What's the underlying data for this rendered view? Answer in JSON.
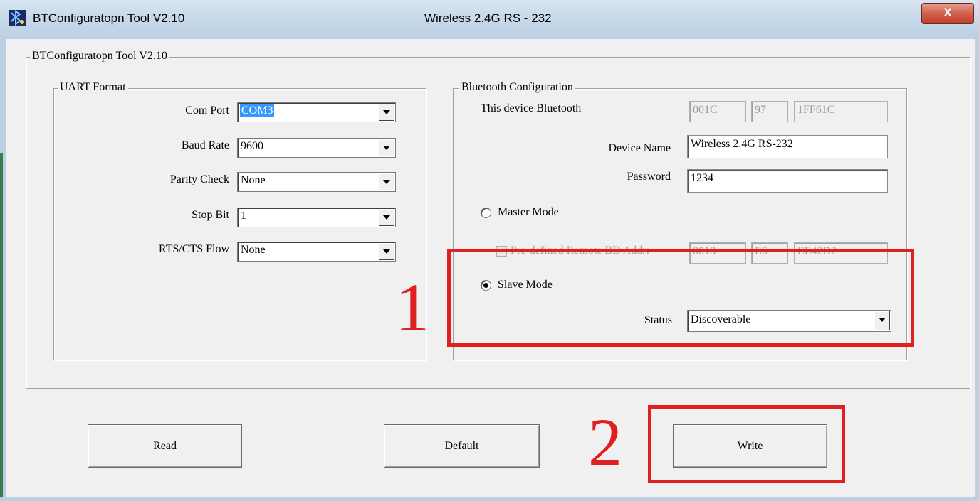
{
  "window": {
    "title": "BTConfiguratopn Tool V2.10",
    "subtitle": "Wireless 2.4G RS - 232",
    "close_label": "X",
    "icon": "bluetooth-app-icon"
  },
  "main_group": {
    "legend": "BTConfiguratopn Tool V2.10"
  },
  "uart": {
    "legend": "UART Format",
    "com_port": {
      "label": "Com Port",
      "value": "COM3"
    },
    "baud_rate": {
      "label": "Baud Rate",
      "value": "9600"
    },
    "parity": {
      "label": "Parity Check",
      "value": "None"
    },
    "stop_bit": {
      "label": "Stop Bit",
      "value": "1"
    },
    "flow": {
      "label": "RTS/CTS Flow",
      "value": "None"
    }
  },
  "bluetooth": {
    "legend": "Bluetooth Configuration",
    "this_device_label": "This device Bluetooth",
    "addr": [
      "001C",
      "97",
      "1FF61C"
    ],
    "device_name_label": "Device Name",
    "device_name": "Wireless 2.4G RS-232",
    "password_label": "Password",
    "password": "1234",
    "master_label": "Master Mode",
    "remote_label": "Pre-defined Remote BD Addr:",
    "remote_addr": [
      "0018",
      "E6",
      "EE42D2"
    ],
    "slave_label": "Slave Mode",
    "status_label": "Status",
    "status_value": "Discoverable"
  },
  "buttons": {
    "read": "Read",
    "default": "Default",
    "write": "Write"
  },
  "annotations": {
    "one": "1",
    "two": "2",
    "color": "#e02020"
  }
}
